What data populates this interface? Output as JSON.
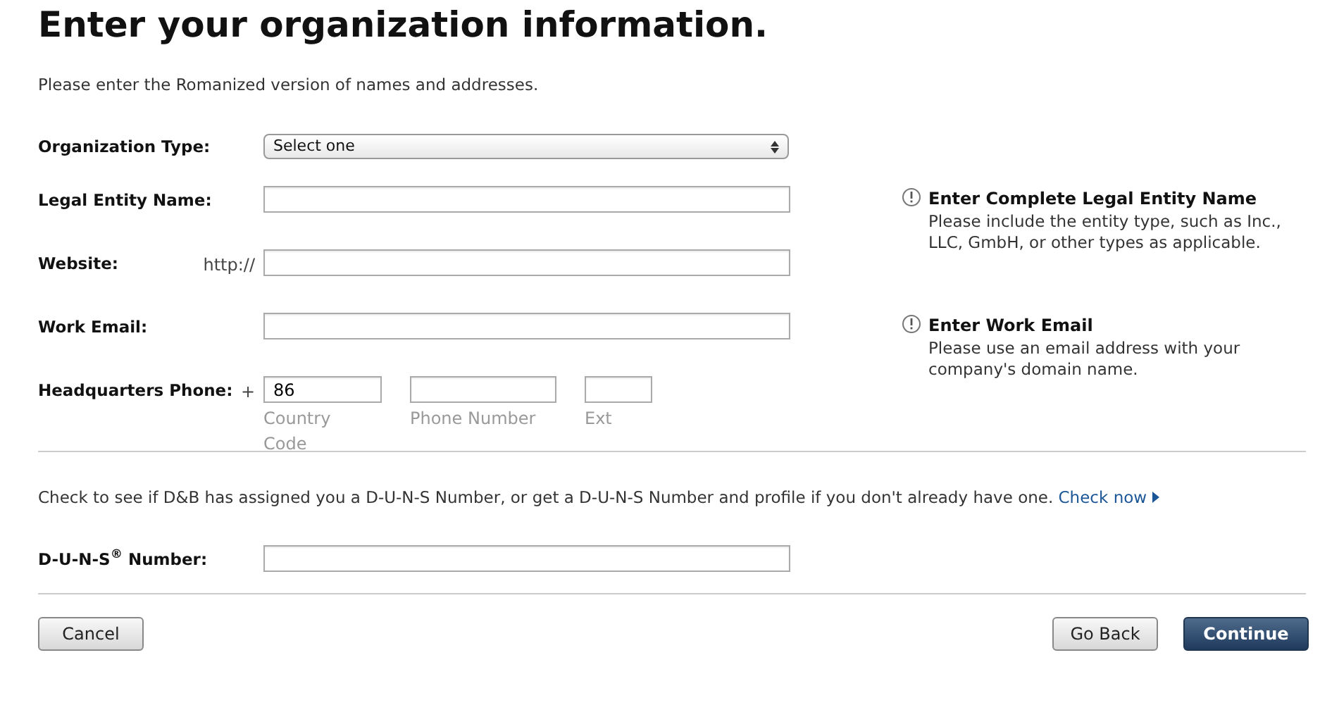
{
  "title": "Enter your organization information.",
  "intro": "Please enter the Romanized version of names and addresses.",
  "fields": [
    {
      "kind": "select",
      "label": "Organization Type:",
      "value": "Select one"
    },
    {
      "kind": "text",
      "label": "Legal Entity Name:",
      "hint": {
        "title": "Enter Complete Legal Entity Name",
        "text": "Please include the entity type, such as Inc., LLC, GmbH, or other types as applicable."
      }
    },
    {
      "kind": "text",
      "label": "Website:",
      "prefix": "http://"
    },
    {
      "kind": "text",
      "label": "Work Email:",
      "hint": {
        "title": "Enter Work Email",
        "text": "Please use an email address with your company's domain name."
      }
    },
    {
      "kind": "phone",
      "label": "Headquarters Phone:",
      "prefix": "+",
      "parts": [
        {
          "value": "86",
          "caption": "Country Code"
        },
        {
          "caption": "Phone Number"
        },
        {
          "caption": "Ext"
        }
      ]
    }
  ],
  "duns_note": {
    "text": "Check to see if D&B has assigned you a D-U-N-S Number, or get a D-U-N-S Number and profile if you don't already have one.",
    "link": "Check now"
  },
  "duns_field": {
    "label": "D-U-N-S$^{®}$ Number:"
  },
  "buttons": [
    {
      "label": "Cancel",
      "kind": "secondary"
    },
    {
      "label": "Go Back",
      "kind": "secondary"
    },
    {
      "label": "Continue",
      "kind": "primary"
    }
  ]
}
